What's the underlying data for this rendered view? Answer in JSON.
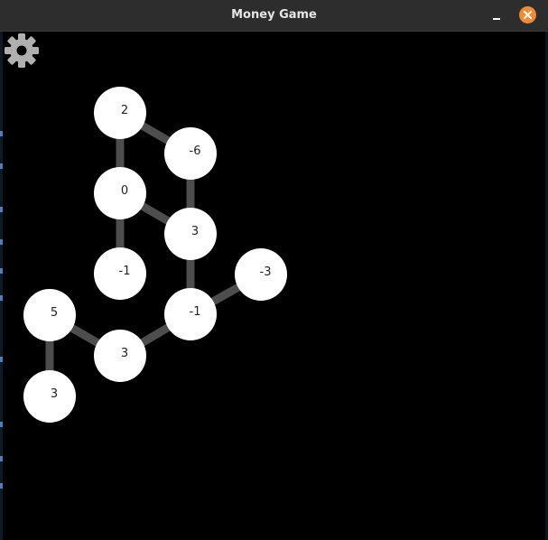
{
  "window": {
    "title": "Money Game"
  },
  "icons": {
    "settings": "gear-icon",
    "minimize": "minimize-icon",
    "close": "close-icon"
  },
  "colors": {
    "background": "#000000",
    "titlebar": "#2d2d2d",
    "title_text": "#e6e6e6",
    "close_button": "#f08a35",
    "node_fill": "#ffffff",
    "node_text": "#222222",
    "edge": "#4d4d4d",
    "settings_icon": "#b0b0b0"
  },
  "graph": {
    "nodes": [
      {
        "id": "n1",
        "value": "2"
      },
      {
        "id": "n2",
        "value": "-6"
      },
      {
        "id": "n3",
        "value": "0"
      },
      {
        "id": "n4",
        "value": "3"
      },
      {
        "id": "n5",
        "value": "-1"
      },
      {
        "id": "n6",
        "value": "-3"
      },
      {
        "id": "n7",
        "value": "5"
      },
      {
        "id": "n8",
        "value": "-1"
      },
      {
        "id": "n9",
        "value": "3"
      },
      {
        "id": "n10",
        "value": "3"
      }
    ],
    "edges": [
      [
        "n1",
        "n2"
      ],
      [
        "n1",
        "n3"
      ],
      [
        "n2",
        "n4"
      ],
      [
        "n3",
        "n4"
      ],
      [
        "n3",
        "n5"
      ],
      [
        "n4",
        "n8"
      ],
      [
        "n6",
        "n8"
      ],
      [
        "n8",
        "n9"
      ],
      [
        "n7",
        "n9"
      ],
      [
        "n7",
        "n10"
      ]
    ]
  }
}
